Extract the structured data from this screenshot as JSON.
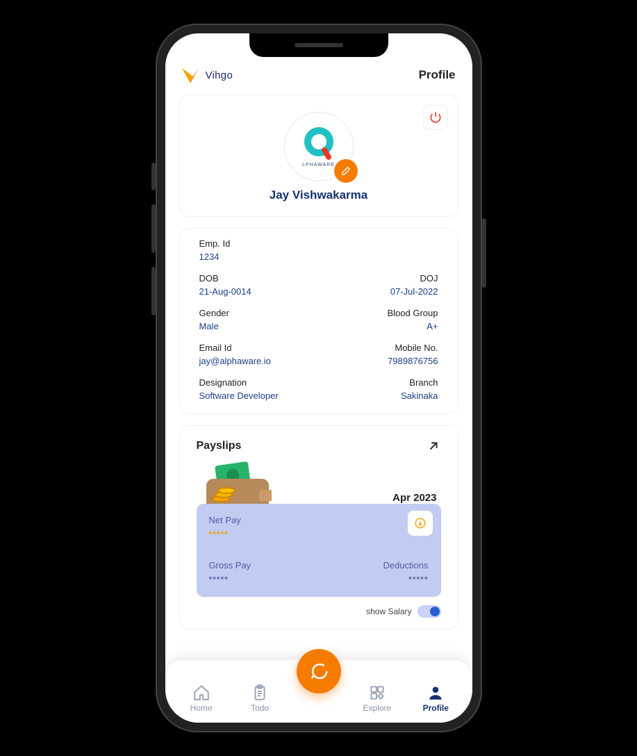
{
  "brand_name": "Vihgo",
  "header_title": "Profile",
  "profile": {
    "name": "Jay Vishwakarma",
    "avatar_label": "LPHAWARE"
  },
  "info": {
    "emp_id_label": "Emp. Id",
    "emp_id": "1234",
    "dob_label": "DOB",
    "dob": "21-Aug-0014",
    "doj_label": "DOJ",
    "doj": "07-Jul-2022",
    "gender_label": "Gender",
    "gender": "Male",
    "blood_label": "Blood Group",
    "blood": "A+",
    "email_label": "Email Id",
    "email": "jay@alphaware.io",
    "mobile_label": "Mobile No.",
    "mobile": "7989876756",
    "designation_label": "Designation",
    "designation": "Software Developer",
    "branch_label": "Branch",
    "branch": "Sakinaka"
  },
  "payslips": {
    "title": "Payslips",
    "month": "Apr 2023",
    "net_pay_label": "Net Pay",
    "net_pay_value": "*****",
    "gross_label": "Gross Pay",
    "gross_value": "*****",
    "deductions_label": "Deductions",
    "deductions_value": "*****",
    "show_salary_label": "show Salary"
  },
  "nav": {
    "home": "Home",
    "todo": "Todo",
    "explore": "Explore",
    "profile": "Profile"
  }
}
